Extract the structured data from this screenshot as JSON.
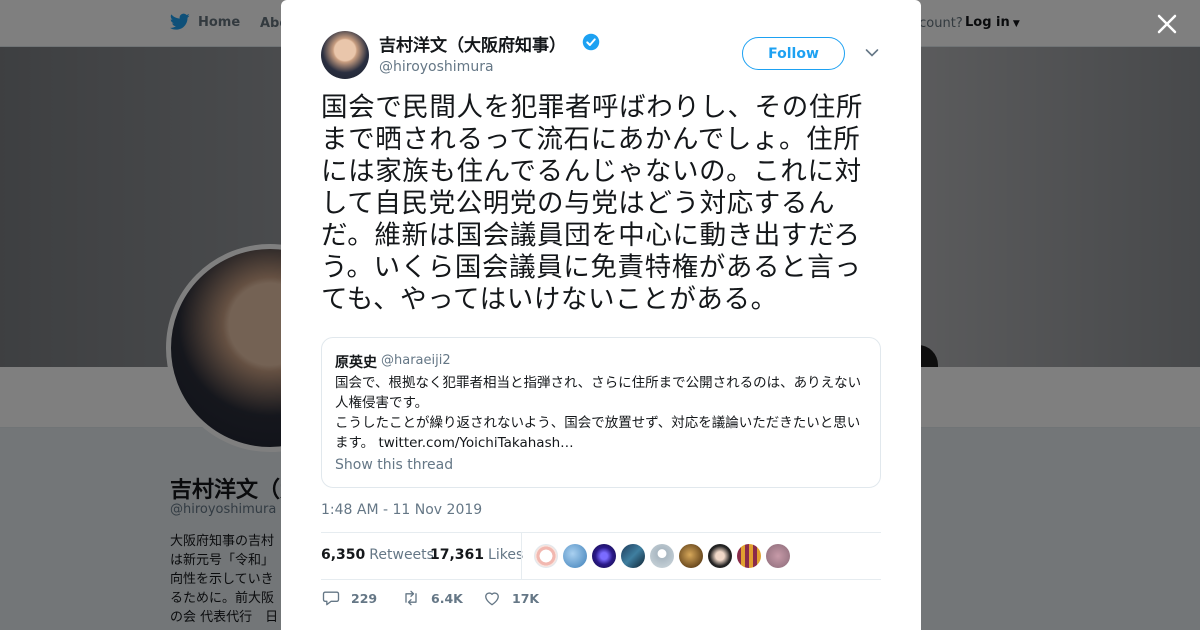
{
  "nav": {
    "home_label": "Home",
    "about_label": "Abo",
    "account_text": "ccount?",
    "login_label": "Log in"
  },
  "background_profile": {
    "name": "吉村洋文（大",
    "handle": "@hiroyoshimura",
    "bio": "大阪府知事の吉村\nは新元号「令和」\n向性を示していき\nるために。前大阪\nの会 代表代行　日"
  },
  "tweet": {
    "author_name": "吉村洋文（大阪府知事）",
    "author_handle": "@hiroyoshimura",
    "follow_label": "Follow",
    "text": "国会で民間人を犯罪者呼ばわりし、その住所まで晒されるって流石にあかんでしょ。住所には家族も住んでるんじゃないの。これに対して自民党公明党の与党はどう対応するんだ。維新は国会議員団を中心に動き出すだろう。いくら国会議員に免責特権があると言っても、やってはいけないことがある。",
    "quote": {
      "name": "原英史",
      "handle": "@haraeiji2",
      "text_1": "国会で、根拠なく犯罪者相当と指弾され、さらに住所まで公開されるのは、ありえない人権侵害です。",
      "text_2": "こうしたことが繰り返されないよう、国会で放置せず、対応を議論いただきたいと思います。",
      "link": "twitter.com/YoichiTakahash…",
      "show_thread": "Show this thread"
    },
    "timestamp": "1:48 AM - 11 Nov 2019",
    "retweets_count": "6,350",
    "retweets_label": "Retweets",
    "likes_count": "17,361",
    "likes_label": "Likes",
    "reply_count": "229",
    "retweet_action_count": "6.4K",
    "like_action_count": "17K"
  },
  "colors": {
    "brand_blue": "#1da1f2",
    "text_primary": "#14171a",
    "text_secondary": "#657786"
  },
  "icons": [
    "twitter-bird-icon",
    "verified-badge-icon",
    "chevron-down-icon",
    "close-icon",
    "reply-icon",
    "retweet-icon",
    "like-icon"
  ]
}
